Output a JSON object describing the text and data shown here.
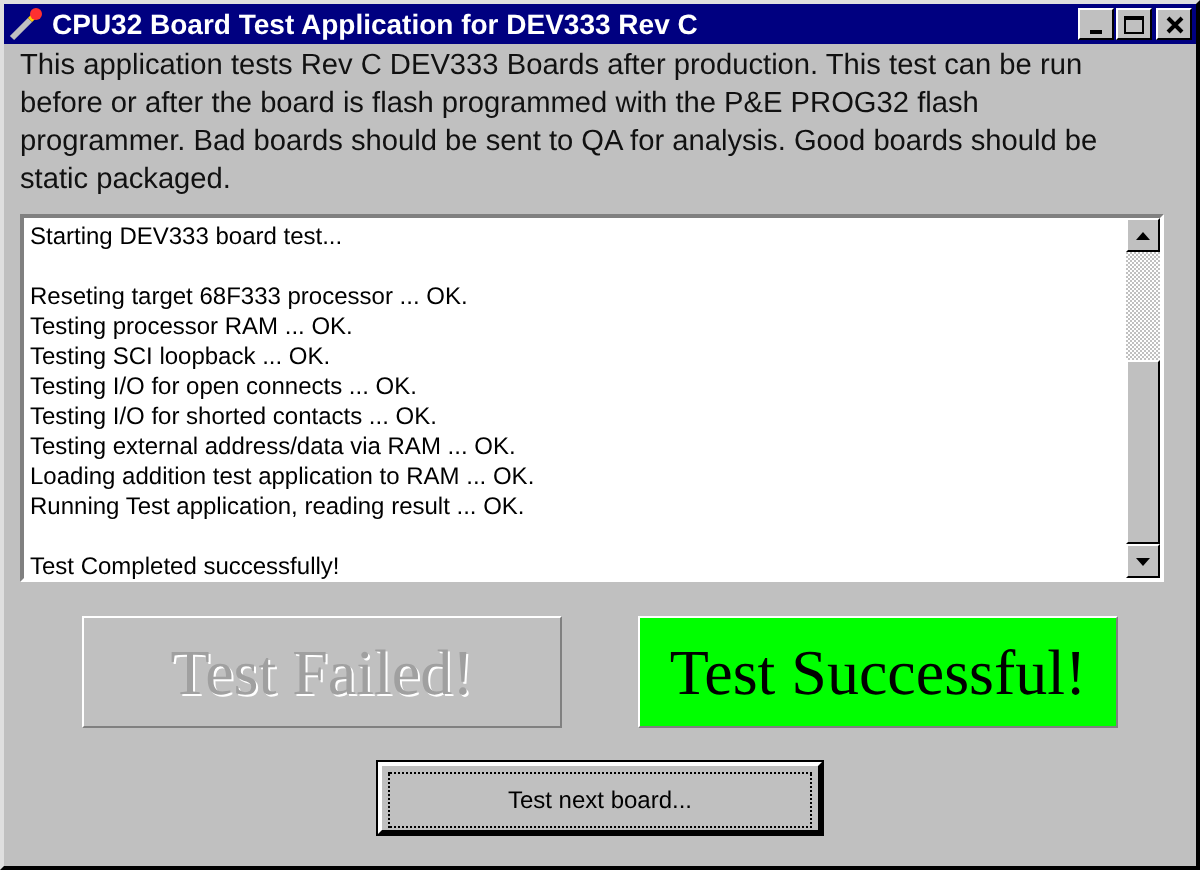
{
  "window": {
    "title": "CPU32 Board Test Application for DEV333 Rev C",
    "controls": [
      {
        "kind": "minimize"
      },
      {
        "kind": "maximize"
      },
      {
        "kind": "close"
      }
    ]
  },
  "description": "This application tests Rev C DEV333 Boards after production.  This test can be run before or after the board is flash programmed with the P&E PROG32 flash programmer. Bad boards should be sent to QA for analysis. Good boards should be static packaged.",
  "log": {
    "groups": [
      [
        "Starting DEV333 board test..."
      ],
      [
        "Reseting target 68F333 processor ... OK.",
        "Testing processor RAM ... OK.",
        "Testing SCI loopback ... OK.",
        "Testing I/O for open connects ... OK.",
        "Testing I/O for shorted contacts ... OK.",
        "Testing external address/data via RAM ... OK.",
        "Loading addition test application to RAM ... OK.",
        "Running Test application, reading result ... OK."
      ],
      [
        "Test Completed successfully!"
      ]
    ]
  },
  "indicators": [
    {
      "label": "Test Failed!",
      "on": false
    },
    {
      "label": "Test Successful!",
      "on": true,
      "color": "#00ff00"
    }
  ],
  "buttons": [
    {
      "label": "Test next board...",
      "focused": true
    }
  ]
}
